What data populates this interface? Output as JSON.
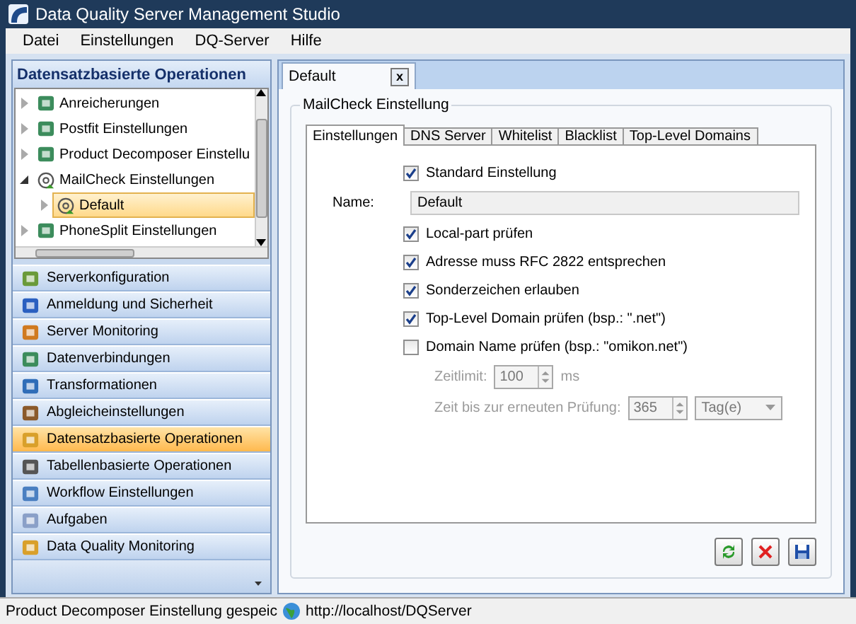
{
  "window": {
    "title": "Data Quality Server Management Studio"
  },
  "menu": [
    "Datei",
    "Einstellungen",
    "DQ-Server",
    "Hilfe"
  ],
  "left_panel": {
    "title": "Datensatzbasierte Operationen",
    "tree": [
      {
        "label": "Anreicherungen",
        "expanded": false,
        "selected": false
      },
      {
        "label": "Postfit Einstellungen",
        "expanded": false,
        "selected": false
      },
      {
        "label": "Product Decomposer Einstellu",
        "expanded": false,
        "selected": false
      },
      {
        "label": "MailCheck Einstellungen",
        "expanded": true,
        "selected": false,
        "children": [
          {
            "label": "Default",
            "expanded": false,
            "selected": true
          }
        ]
      },
      {
        "label": "PhoneSplit Einstellungen",
        "expanded": false,
        "selected": false
      }
    ],
    "nav": [
      {
        "label": "Serverkonfiguration",
        "selected": false
      },
      {
        "label": "Anmeldung und Sicherheit",
        "selected": false
      },
      {
        "label": "Server Monitoring",
        "selected": false
      },
      {
        "label": "Datenverbindungen",
        "selected": false
      },
      {
        "label": "Transformationen",
        "selected": false
      },
      {
        "label": "Abgleicheinstellungen",
        "selected": false
      },
      {
        "label": "Datensatzbasierte Operationen",
        "selected": true
      },
      {
        "label": "Tabellenbasierte Operationen",
        "selected": false
      },
      {
        "label": "Workflow Einstellungen",
        "selected": false
      },
      {
        "label": "Aufgaben",
        "selected": false
      },
      {
        "label": "Data Quality Monitoring",
        "selected": false
      }
    ]
  },
  "document_tabs": [
    {
      "label": "Default",
      "close": "x",
      "selected": true
    }
  ],
  "group": {
    "title": "MailCheck Einstellung",
    "tabs": [
      {
        "label": "Einstellungen",
        "selected": true
      },
      {
        "label": "DNS Server",
        "selected": false
      },
      {
        "label": "Whitelist",
        "selected": false
      },
      {
        "label": "Blacklist",
        "selected": false
      },
      {
        "label": "Top-Level Domains",
        "selected": false
      }
    ],
    "settings": [
      {
        "kind": "checkbox",
        "label": "Standard Einstellung",
        "checked": true
      },
      {
        "kind": "text",
        "label": "Name:",
        "value": "Default",
        "disabled": true
      },
      {
        "kind": "checkbox",
        "label": "Local-part prüfen",
        "checked": true
      },
      {
        "kind": "checkbox",
        "label": "Adresse muss RFC 2822 entsprechen",
        "checked": true
      },
      {
        "kind": "checkbox",
        "label": "Sonderzeichen erlauben",
        "checked": true
      },
      {
        "kind": "checkbox",
        "label": "Top-Level Domain prüfen (bsp.: \".net\")",
        "checked": true
      },
      {
        "kind": "checkbox",
        "label": "Domain Name prüfen (bsp.: \"omikon.net\")",
        "checked": false
      },
      {
        "kind": "spinner",
        "label": "Zeitlimit:",
        "value": "100",
        "unit": "ms",
        "disabled": true
      },
      {
        "kind": "spinner_select",
        "label": "Zeit bis zur erneuten Prüfung:",
        "value": "365",
        "select": "Tag(e)",
        "disabled": true
      }
    ]
  },
  "status_bar": {
    "message": "Product Decomposer Einstellung gespeic",
    "url": "http://localhost/DQServer"
  }
}
